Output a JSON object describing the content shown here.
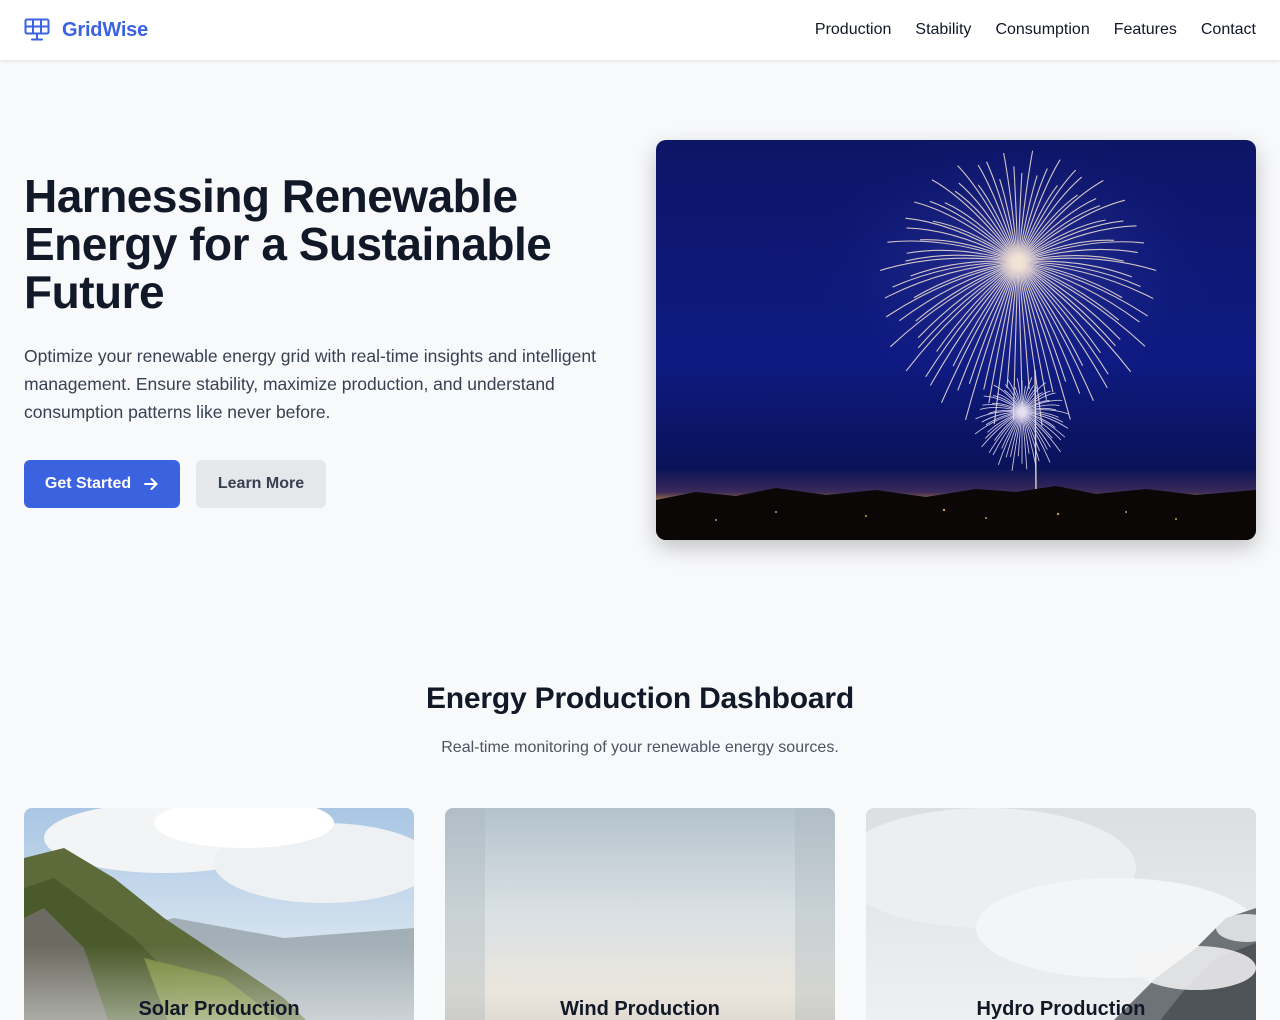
{
  "brand": {
    "name": "GridWise",
    "icon": "solar-panel-icon"
  },
  "nav": {
    "items": [
      "Production",
      "Stability",
      "Consumption",
      "Features",
      "Contact"
    ]
  },
  "hero": {
    "title": "Harnessing Renewable Energy for a Sustainable Future",
    "description": "Optimize your renewable energy grid with real-time insights and intelligent management. Ensure stability, maximize production, and understand consumption patterns like never before.",
    "primary_button": "Get Started",
    "primary_icon": "arrow-right-icon",
    "secondary_button": "Learn More",
    "image": "fireworks-photo"
  },
  "dashboard": {
    "title": "Energy Production Dashboard",
    "subtitle": "Real-time monitoring of your renewable energy sources.",
    "cards": [
      {
        "title": "Solar Production",
        "image": "mountain-valley-photo"
      },
      {
        "title": "Wind Production",
        "image": "misty-sky-photo"
      },
      {
        "title": "Hydro Production",
        "image": "cloudy-mountain-photo"
      }
    ]
  },
  "colors": {
    "accent": "#3b63e0",
    "page_background": "#f8f9fb",
    "heading": "#111827",
    "body_text": "#374151",
    "secondary_button": "#e5e7eb"
  }
}
